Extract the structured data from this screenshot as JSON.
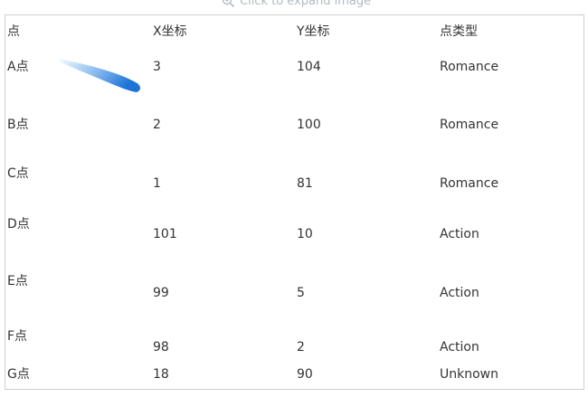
{
  "hint": {
    "label": "Click to expand image"
  },
  "table": {
    "headers": [
      "点",
      "X坐标",
      "Y坐标",
      "点类型"
    ],
    "rows": [
      [
        "A点",
        "3",
        "104",
        "Romance"
      ],
      [
        "B点",
        "2",
        "100",
        "Romance"
      ],
      [
        "C点",
        "1",
        "81",
        "Romance"
      ],
      [
        "D点",
        "101",
        "10",
        "Action"
      ],
      [
        "E点",
        "99",
        "5",
        "Action"
      ],
      [
        "F点",
        "98",
        "2",
        "Action"
      ],
      [
        "G点",
        "18",
        "90",
        "Unknown"
      ]
    ]
  },
  "colors": {
    "text": "#333333",
    "border": "#d0d0d0",
    "stroke": "#2a86e8",
    "hint": "#9aa3ad"
  },
  "icons": [
    "zoom-in-icon"
  ]
}
